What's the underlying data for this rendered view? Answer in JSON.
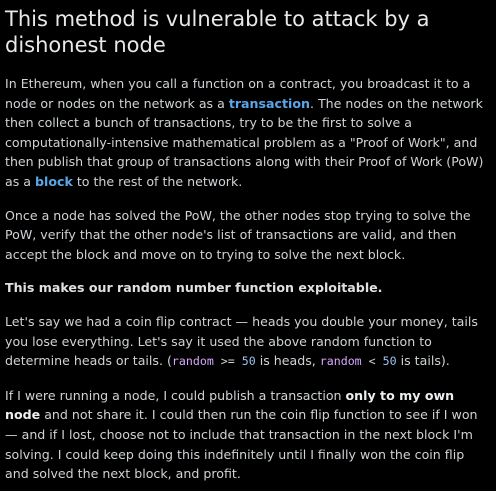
{
  "title": "This method is vulnerable to attack by a dishonest node",
  "paragraphs": {
    "p1": {
      "before_link1": "In Ethereum, when you call a function on a contract, you broadcast it to a node or nodes on the network as a ",
      "link1": "transaction",
      "mid": ". The nodes on the network then collect a bunch of transactions, try to be the first to solve a computationally-intensive mathematical problem as a \"Proof of Work\", and then publish that group of transactions along with their Proof of Work (PoW) as a ",
      "link2": "block",
      "after_link2": " to the rest of the network."
    },
    "p2": "Once a node has solved the PoW, the other nodes stop trying to solve the PoW, verify that the other node's list of transactions are valid, and then accept the block and move on to trying to solve the next block.",
    "p3": "This makes our random number function exploitable.",
    "p4": {
      "text1": "Let's say we had a coin flip contract — heads you double your money, tails you lose everything. Let's say it used the above random function to determine heads or tails. (",
      "code1_var": "random",
      "code1_op": " >= ",
      "code1_num": "50",
      "text2": " is heads, ",
      "code2_var": "random",
      "code2_op": " < ",
      "code2_num": "50",
      "text3": " is tails)."
    },
    "p5": {
      "text1": "If I were running a node, I could publish a transaction ",
      "strong": "only to my own node",
      "text2": " and not share it. I could then run the coin flip function to see if I won — and if I lost, choose not to include that transaction in the next block I'm solving. I could keep doing this indefinitely until I finally won the coin flip and solved the next block, and profit."
    }
  },
  "colors": {
    "background": "#000000",
    "text": "#cfd3d6",
    "link": "#5aa7e8",
    "code_keyword": "#d9a6ff",
    "code_number": "#9bc4f0"
  }
}
